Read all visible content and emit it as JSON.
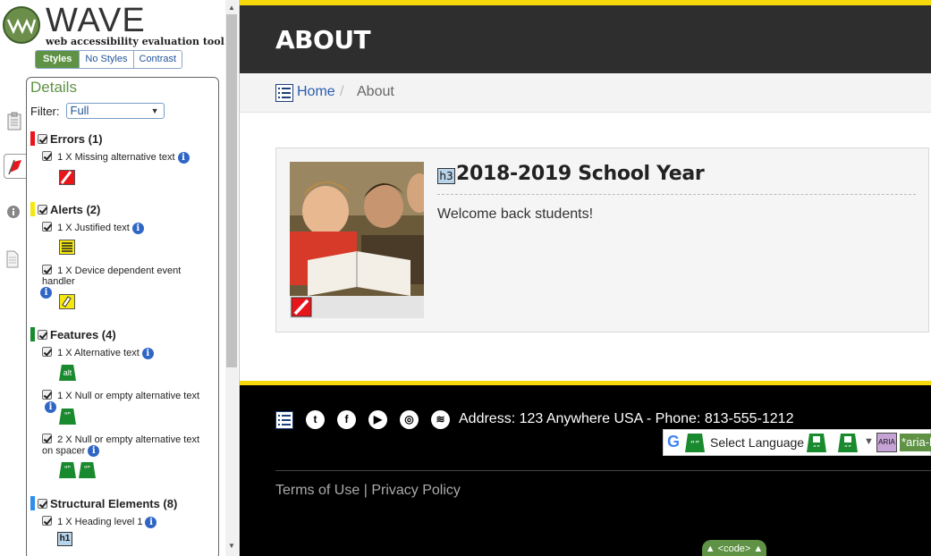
{
  "wave": {
    "logo_word": "WAVE",
    "tagline": "web accessibility evaluation tool",
    "view_tabs": [
      "Styles",
      "No Styles",
      "Contrast"
    ],
    "details_title": "Details",
    "filter_label": "Filter:",
    "filter_value": "Full",
    "categories": {
      "errors": {
        "label": "Errors (1)",
        "color": "#e8151b"
      },
      "alerts": {
        "label": "Alerts (2)",
        "color": "#f5e70f"
      },
      "features": {
        "label": "Features (4)",
        "color": "#1a8a2e"
      },
      "structural": {
        "label": "Structural Elements (8)",
        "color": "#2f8fe8"
      }
    },
    "items": {
      "missing_alt": "1 X Missing alternative text",
      "justified": "1 X Justified text",
      "device_handler": "1 X Device dependent event handler",
      "alt_text": "1 X Alternative text",
      "null_alt": "1 X Null or empty alternative text",
      "null_alt_spacer": "2 X Null or empty alternative text on spacer",
      "heading1": "1 X Heading level 1"
    },
    "icon_labels": {
      "alt": "alt",
      "h1": "h1",
      "quote": "“”"
    }
  },
  "page": {
    "title": "ABOUT",
    "breadcrumb": {
      "home": "Home",
      "separator": "/",
      "current": "About"
    },
    "card": {
      "heading_tag": "h3",
      "heading": "2018-2019 School Year",
      "body": "Welcome back students!"
    },
    "footer": {
      "address": "Address: 123 Anywhere USA - Phone: 813-555-1212",
      "translate_label": "Select Language",
      "aria_label": "ARIA",
      "aria_attr": "*aria-l",
      "terms": "Terms of Use",
      "divider": "|",
      "privacy": "Privacy Policy",
      "code_toggle": "▲ <code> ▲"
    }
  }
}
